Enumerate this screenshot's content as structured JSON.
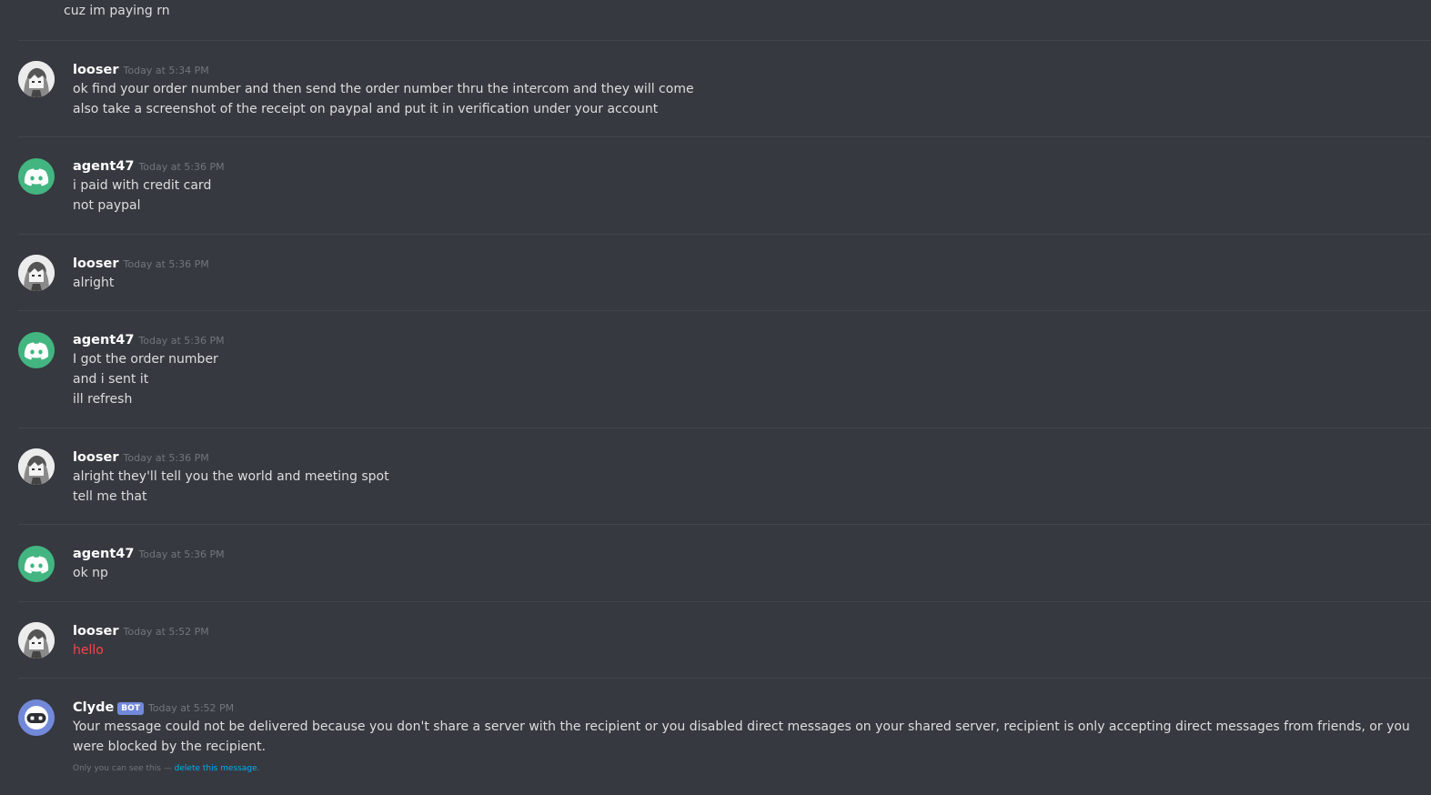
{
  "messages": [
    {
      "author": "",
      "timestamp": "",
      "lines": [
        "cuz im paying rn"
      ]
    },
    {
      "author": "looser",
      "avatar": "anime-avatar",
      "timestamp": "Today at 5:34 PM",
      "lines": [
        "ok find your order number and then send the order number thru the intercom and they will come",
        "also take a screenshot of the receipt on paypal and put it in verification under your account"
      ]
    },
    {
      "author": "agent47",
      "avatar": "discord-default-icon",
      "timestamp": "Today at 5:36 PM",
      "lines": [
        "i paid with credit card",
        "not paypal"
      ]
    },
    {
      "author": "looser",
      "avatar": "anime-avatar",
      "timestamp": "Today at 5:36 PM",
      "lines": [
        "alright"
      ]
    },
    {
      "author": "agent47",
      "avatar": "discord-default-icon",
      "timestamp": "Today at 5:36 PM",
      "lines": [
        "I got the order number",
        "and i sent it",
        "ill refresh"
      ]
    },
    {
      "author": "looser",
      "avatar": "anime-avatar",
      "timestamp": "Today at 5:36 PM",
      "lines": [
        "alright they'll tell you the world and meeting spot",
        "tell me that"
      ]
    },
    {
      "author": "agent47",
      "avatar": "discord-default-icon",
      "timestamp": "Today at 5:36 PM",
      "lines": [
        "ok np"
      ]
    },
    {
      "author": "looser",
      "avatar": "anime-avatar",
      "timestamp": "Today at 5:52 PM",
      "lines": [
        "hello"
      ],
      "failed": true
    },
    {
      "author": "Clyde",
      "avatar": "clyde-bot-icon",
      "bot_tag": "BOT",
      "timestamp": "Today at 5:52 PM",
      "lines": [
        "Your message could not be delivered because you don't share a server with the recipient or you disabled direct messages on your shared server, recipient is only accepting direct messages from friends, or you were blocked by the recipient."
      ],
      "ephemeral_note": "Only you can see this — ",
      "ephemeral_link": "delete this message",
      "ephemeral_end": "."
    }
  ],
  "colors": {
    "background": "#36393f",
    "divider": "#42454a",
    "username": "#ffffff",
    "timestamp": "#72767d",
    "text": "#dcddde",
    "failed_text": "#f04747",
    "link": "#00b0f4",
    "agent_avatar": "#43b581",
    "clyde_avatar": "#7289da"
  }
}
